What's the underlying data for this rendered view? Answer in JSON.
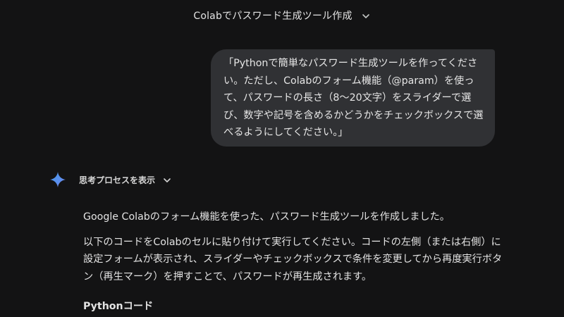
{
  "header": {
    "title": "Colabでパスワード生成ツール作成",
    "dropdown_icon": "chevron-down-icon"
  },
  "user_message": {
    "text": "「Pythonで簡単なパスワード生成ツールを作ってください。ただし、Colabのフォーム機能（@param）を使って、パスワードの長さ（8〜20文字）をスライダーで選び、数字や記号を含めるかどうかをチェックボックスで選べるようにしてください。」"
  },
  "thinking": {
    "label": "思考プロセスを表示",
    "icon": "gemini-sparkle-icon",
    "expand_icon": "chevron-down-icon"
  },
  "response": {
    "paragraph1": "Google Colabのフォーム機能を使った、パスワード生成ツールを作成しました。",
    "paragraph2": "以下のコードをColabのセルに貼り付けて実行してください。コードの左側（または右側）に設定フォームが表示され、スライダーやチェックボックスで条件を変更してから再度実行ボタン（再生マーク）を押すことで、パスワードが再生成されます。",
    "code_heading": "Pythonコード"
  },
  "colors": {
    "background": "#131314",
    "bubble": "#303134",
    "sparkle_blue": "#4796e3"
  }
}
